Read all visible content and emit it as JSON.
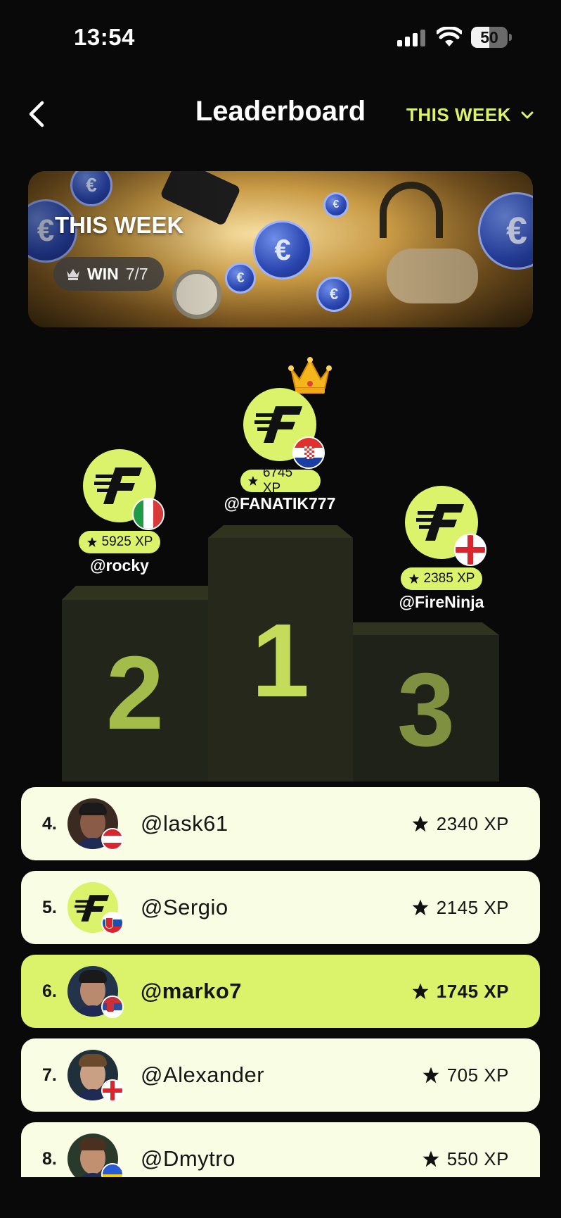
{
  "status_bar": {
    "time": "13:54",
    "battery": "50",
    "battery_level": 0.5
  },
  "header": {
    "title": "Leaderboard",
    "period_label": "THIS WEEK"
  },
  "banner": {
    "title": "THIS WEEK",
    "win_label": "WIN",
    "win_count": "7/7"
  },
  "podium": [
    {
      "place": "1",
      "username": "@FANATIK777",
      "xp": "6745 XP",
      "flag": "croatia"
    },
    {
      "place": "2",
      "username": "@rocky",
      "xp": "5925 XP",
      "flag": "italy"
    },
    {
      "place": "3",
      "username": "@FireNinja",
      "xp": "2385 XP",
      "flag": "england"
    }
  ],
  "rows": [
    {
      "rank": "4.",
      "username": "@lask61",
      "xp": "2340 XP",
      "flag": "austria",
      "avatar": "photo"
    },
    {
      "rank": "5.",
      "username": "@Sergio",
      "xp": "2145 XP",
      "flag": "slovakia",
      "avatar": "logo"
    },
    {
      "rank": "6.",
      "username": "@marko7",
      "xp": "1745 XP",
      "flag": "serbia",
      "avatar": "photo",
      "current_user": true
    },
    {
      "rank": "7.",
      "username": "@Alexander",
      "xp": "705 XP",
      "flag": "england",
      "avatar": "photo"
    },
    {
      "rank": "8.",
      "username": "@Dmytro",
      "xp": "550 XP",
      "flag": "ukraine",
      "avatar": "photo"
    }
  ],
  "colors": {
    "accent": "#dbf26b",
    "row_bg": "#f8fde3",
    "background": "#090909",
    "podium": "#25281a"
  }
}
